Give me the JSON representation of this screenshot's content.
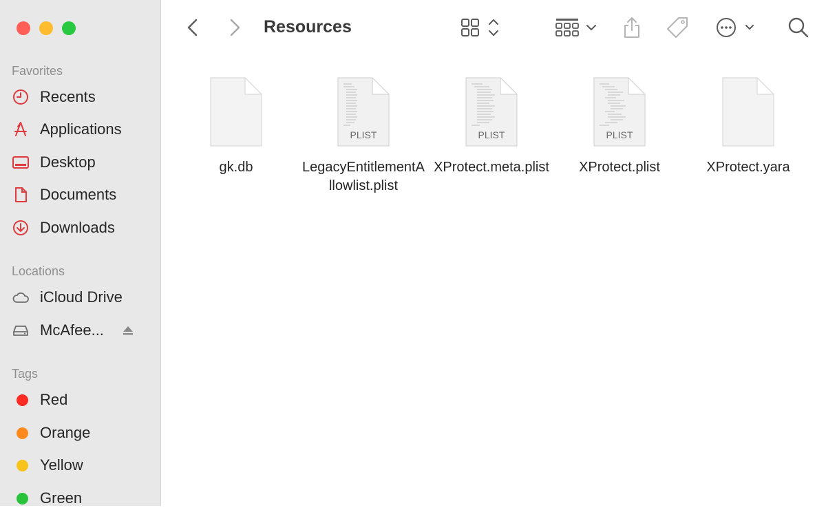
{
  "window": {
    "title": "Resources"
  },
  "sidebar": {
    "favorites_title": "Favorites",
    "favorites": [
      {
        "label": "Recents",
        "icon": "clock-icon"
      },
      {
        "label": "Applications",
        "icon": "applications-icon"
      },
      {
        "label": "Desktop",
        "icon": "desktop-icon"
      },
      {
        "label": "Documents",
        "icon": "document-icon"
      },
      {
        "label": "Downloads",
        "icon": "download-icon"
      }
    ],
    "locations_title": "Locations",
    "locations": [
      {
        "label": "iCloud Drive",
        "icon": "cloud-icon"
      },
      {
        "label": "McAfee...",
        "icon": "drive-icon"
      }
    ],
    "tags_title": "Tags",
    "tags": [
      {
        "label": "Red",
        "color": "#fe2b22"
      },
      {
        "label": "Orange",
        "color": "#fe8a1d"
      },
      {
        "label": "Yellow",
        "color": "#f8c31b"
      },
      {
        "label": "Green",
        "color": "#29c23b"
      }
    ]
  },
  "files": [
    {
      "name": "gk.db",
      "kind": "blank"
    },
    {
      "name": "LegacyEntitlementAllowlist.plist",
      "kind": "plist",
      "badge": "PLIST"
    },
    {
      "name": "XProtect.meta.plist",
      "kind": "plist",
      "badge": "PLIST"
    },
    {
      "name": "XProtect.plist",
      "kind": "plist",
      "badge": "PLIST"
    },
    {
      "name": "XProtect.yara",
      "kind": "blank"
    }
  ],
  "colors": {
    "accent": "#e03a3e",
    "sidebar_bg": "#e8e8e8"
  }
}
